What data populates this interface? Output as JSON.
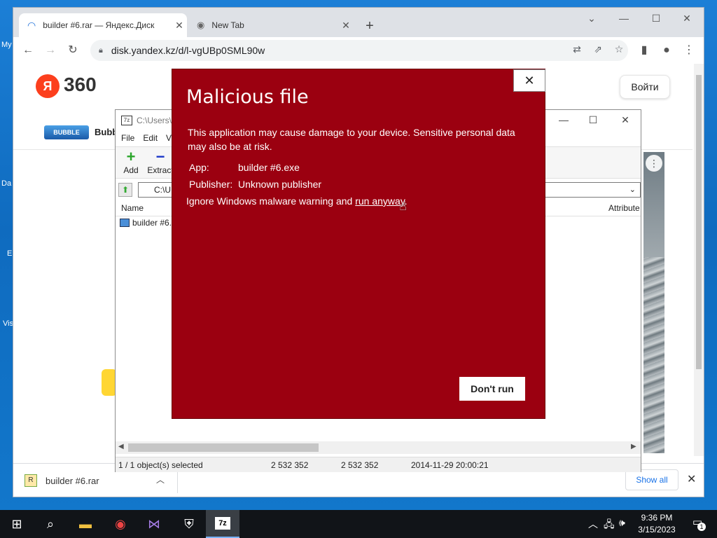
{
  "desktop": {
    "labels": [
      "My",
      "Da",
      "E",
      "Vis"
    ]
  },
  "browser": {
    "tabs": [
      {
        "title": "builder #6.rar — Яндекс.Диск",
        "active": true
      },
      {
        "title": "New Tab",
        "active": false
      }
    ],
    "url": "disk.yandex.kz/d/l-vgUBp0SML90w",
    "page": {
      "logo_text": "Я",
      "logo_suffix": "360",
      "login_label": "Войти",
      "bubble_logo": "BUBBLE",
      "bubble_text": "Bubb"
    },
    "download": {
      "file": "builder #6.rar",
      "show_all": "Show all"
    }
  },
  "sevenzip": {
    "title_path": "C:\\Users\\",
    "menu": [
      "File",
      "Edit",
      "V"
    ],
    "tools": [
      {
        "label": "Add",
        "glyph": "+"
      },
      {
        "label": "Extract",
        "glyph": "−"
      }
    ],
    "address": "C:\\U",
    "columns": {
      "name": "Name",
      "attributes": "Attribute"
    },
    "row_name": "builder #6.",
    "status": {
      "selected": "1 / 1 object(s) selected",
      "size": "2 532 352",
      "packed": "2 532 352",
      "modified": "2014-11-29 20:00:21"
    }
  },
  "dialog": {
    "title": "Malicious file",
    "description": "This application may cause damage to your device. Sensitive personal data may also be at risk.",
    "app_label": "App:",
    "app_value": "builder #6.exe",
    "publisher_label": "Publisher:",
    "publisher_value": "Unknown publisher",
    "ignore_text": "Ignore Windows malware warning and ",
    "run_anyway": "run anyway",
    "ignore_end": ".",
    "dont_run": "Don't run",
    "colors": {
      "background": "#9b0010"
    }
  },
  "taskbar": {
    "time": "9:36 PM",
    "date": "3/15/2023",
    "sevenzip_label": "7z",
    "notifications": "1"
  }
}
